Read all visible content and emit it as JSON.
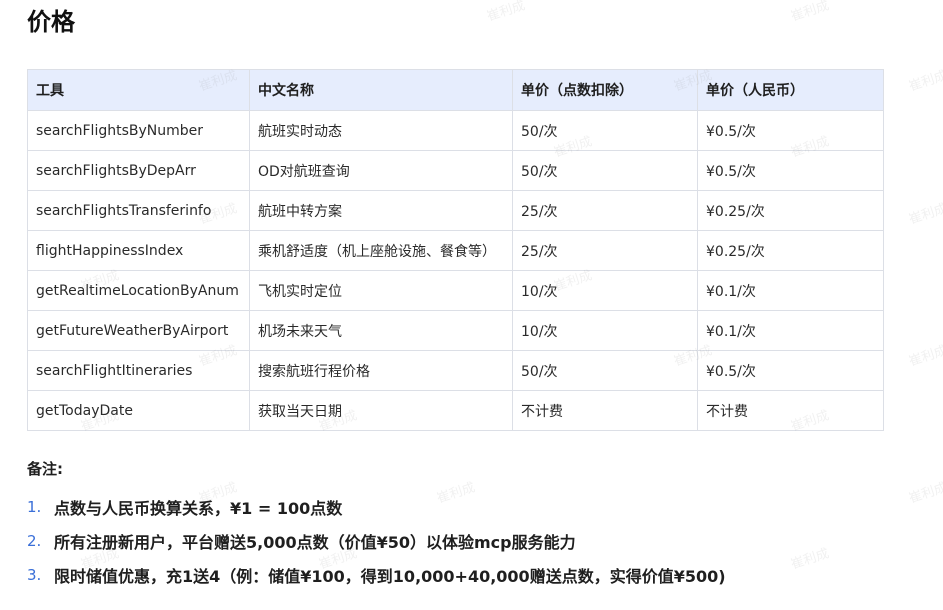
{
  "page": {
    "title": "价格"
  },
  "pricing_table": {
    "headers": [
      "工具",
      "中文名称",
      "单价（点数扣除）",
      "单价（人民币）"
    ],
    "rows": [
      [
        "searchFlightsByNumber",
        "航班实时动态",
        "50/次",
        "¥0.5/次"
      ],
      [
        "searchFlightsByDepArr",
        "OD对航班查询",
        "50/次",
        "¥0.5/次"
      ],
      [
        "searchFlightsTransferinfo",
        "航班中转方案",
        "25/次",
        "¥0.25/次"
      ],
      [
        "flightHappinessIndex",
        "乘机舒适度（机上座舱设施、餐食等）",
        "25/次",
        "¥0.25/次"
      ],
      [
        "getRealtimeLocationByAnum",
        "飞机实时定位",
        "10/次",
        "¥0.1/次"
      ],
      [
        "getFutureWeatherByAirport",
        "机场未来天气",
        "10/次",
        "¥0.1/次"
      ],
      [
        "searchFlightItineraries",
        "搜索航班行程价格",
        "50/次",
        "¥0.5/次"
      ],
      [
        "getTodayDate",
        "获取当天日期",
        "不计费",
        "不计费"
      ]
    ]
  },
  "notes": {
    "title": "备注:",
    "items": [
      {
        "num": "1.",
        "text": "点数与人民币换算关系，¥1 = 100点数"
      },
      {
        "num": "2.",
        "text": "所有注册新用户，平台赠送5,000点数（价值¥50）以体验mcp服务能力"
      },
      {
        "num": "3.",
        "text": "限时储值优惠，充1送4（例：储值¥100，得到10,000+40,000赠送点数，实得价值¥500)"
      }
    ]
  },
  "watermark": {
    "text": "崔利成"
  }
}
